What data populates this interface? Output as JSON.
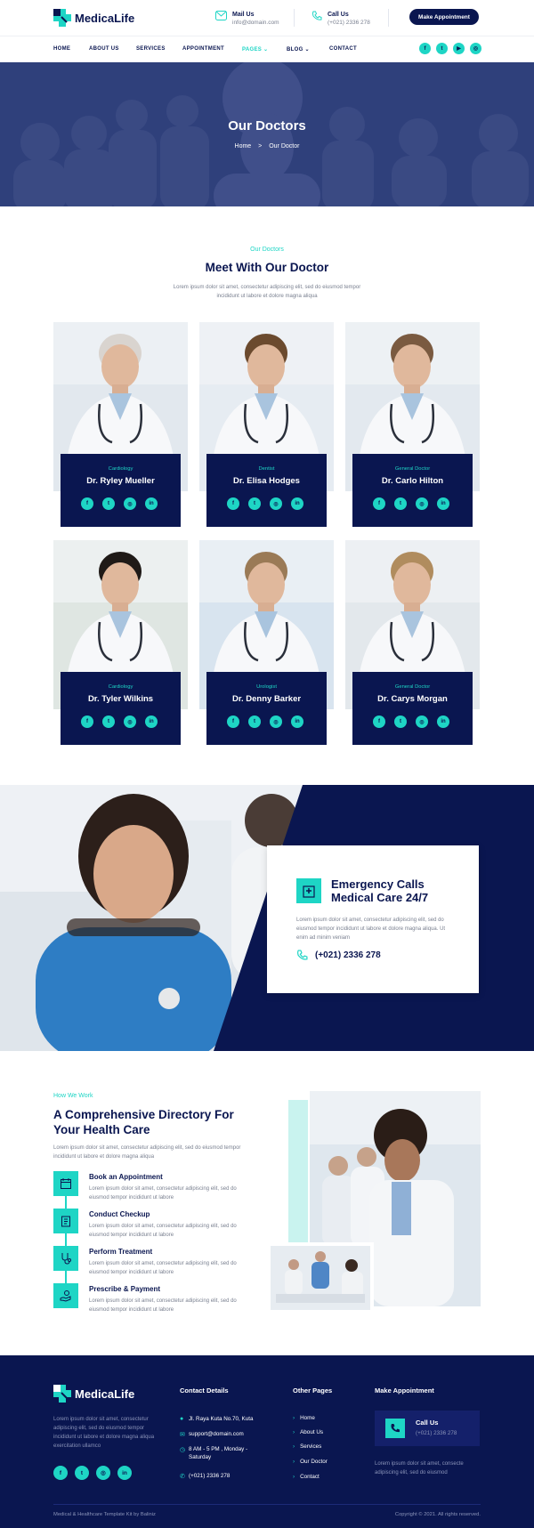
{
  "brand": {
    "name": "MedicaLife",
    "accent": "#1ed5c5",
    "navy": "#0a1650"
  },
  "header": {
    "mail": {
      "title": "Mail Us",
      "value": "info@domain.com",
      "icon": "mail-icon"
    },
    "call": {
      "title": "Call Us",
      "value": "(+021) 2336 278",
      "icon": "phone-icon"
    },
    "appointment_button": "Make Appointment"
  },
  "nav": {
    "items": [
      {
        "label": "HOME"
      },
      {
        "label": "ABOUT US"
      },
      {
        "label": "SERVICES"
      },
      {
        "label": "APPOINTMENT"
      },
      {
        "label": "PAGES",
        "active": true,
        "dropdown": true
      },
      {
        "label": "BLOG",
        "dropdown": true
      },
      {
        "label": "CONTACT"
      }
    ],
    "social": [
      "facebook-icon",
      "twitter-icon",
      "youtube-icon",
      "instagram-icon"
    ],
    "social_glyphs": [
      "f",
      "t",
      "▶",
      "◎"
    ]
  },
  "hero": {
    "title": "Our Doctors",
    "crumb_home": "Home",
    "crumb_sep": ">",
    "crumb_current": "Our Doctor"
  },
  "doctors_section": {
    "kicker": "Our Doctors",
    "title": "Meet With Our Doctor",
    "desc": "Lorem ipsum dolor sit amet, consectetur adipiscing elit, sed do eiusmod tempor incididunt ut labore et dolore magna aliqua",
    "social_glyphs": [
      "f",
      "t",
      "◎",
      "in"
    ],
    "doctors": [
      {
        "specialty": "Cardiology",
        "name": "Dr. Ryley Mueller"
      },
      {
        "specialty": "Dentist",
        "name": "Dr. Elisa Hodges"
      },
      {
        "specialty": "General Doctor",
        "name": "Dr. Carlo Hilton"
      },
      {
        "specialty": "Cardiology",
        "name": "Dr. Tyler Wilkins"
      },
      {
        "specialty": "Urologist",
        "name": "Dr. Denny Barker"
      },
      {
        "specialty": "General Doctor",
        "name": "Dr. Carys Morgan"
      }
    ]
  },
  "emergency": {
    "title_line1": "Emergency Calls",
    "title_line2": "Medical Care 24/7",
    "desc": "Lorem ipsum dolor sit amet, consectetur adipiscing elit, sed do eiusmod tempor incididunt ut labore et dolore magna aliqua. Ut enim ad minim veniam",
    "phone": "(+021) 2336 278"
  },
  "how_we_work": {
    "kicker": "How We Work",
    "title": "A Comprehensive Directory For Your Health Care",
    "desc": "Lorem ipsum dolor sit amet, consectetur adipiscing elit, sed do eiusmod tempor incididunt ut labore et dolore magna aliqua",
    "steps": [
      {
        "title": "Book an Appointment",
        "desc": "Lorem ipsum dolor sit amet, consectetur adipiscing elit, sed do eiusmod tempor incididunt ut labore"
      },
      {
        "title": "Conduct Checkup",
        "desc": "Lorem ipsum dolor sit amet, consectetur adipiscing elit, sed do eiusmod tempor incididunt ut labore"
      },
      {
        "title": "Perform Treatment",
        "desc": "Lorem ipsum dolor sit amet, consectetur adipiscing elit, sed do eiusmod tempor incididunt ut labore"
      },
      {
        "title": "Prescribe & Payment",
        "desc": "Lorem ipsum dolor sit amet, consectetur adipiscing elit, sed do eiusmod tempor incididunt ut labore"
      }
    ]
  },
  "footer": {
    "about": "Lorem ipsum dolor sit amet, consectetur adipiscing elit, sed do eiusmod tempor incididunt ut labore et dolore magna aliqua exercitation ullamco",
    "social_glyphs": [
      "f",
      "t",
      "◎",
      "in"
    ],
    "contact_heading": "Contact Details",
    "address": "Jl. Raya Kuta No.70, Kuta",
    "email": "support@domain.com",
    "hours": "8 AM - 5 PM , Monday - Saturday",
    "phone": "(+021) 2336 278",
    "pages_heading": "Other Pages",
    "pages": [
      "Home",
      "About Us",
      "Services",
      "Our Doctor",
      "Contact"
    ],
    "appt_heading": "Make Appointment",
    "call_title": "Call Us",
    "call_value": "(+021) 2336 278",
    "appt_desc": "Lorem ipsum dolor sit amet, consecte adipiscing elit, sed do eiusmod",
    "credit": "Medical & Healthcare Template Kit by Baliniz",
    "copyright": "Copyright © 2021. All rights reserved."
  }
}
